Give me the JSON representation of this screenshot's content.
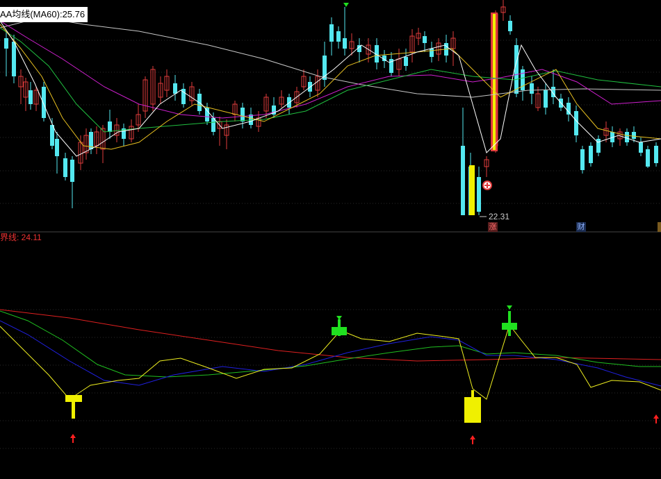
{
  "header": {
    "ma_label": "AA均线(MA60):25.76",
    "indicator_label": "界线: 24.11"
  },
  "annotations": {
    "low_price": "22.31",
    "badge_zhang": "涨",
    "badge_cai": "财"
  },
  "colors": {
    "background": "#000000",
    "up_candle": "#e03c3c",
    "down_candle": "#54e8f0",
    "ma_white": "#ffffff",
    "ma_yellow": "#e8c020",
    "ma_magenta": "#d020d0",
    "ma_green": "#20c040",
    "ma_gray": "#c8c8c8",
    "ind_red": "#e02020",
    "ind_green": "#20c020",
    "ind_blue": "#2020e0",
    "ind_yellow": "#f0f020",
    "signal_yellow": "#f0f000",
    "signal_green": "#20e020"
  },
  "chart_data": {
    "type": "line",
    "panels": [
      "price",
      "indicator"
    ],
    "price_series": [
      "white",
      "yellow",
      "magenta",
      "green",
      "gray"
    ],
    "ma60_value": 25.76,
    "indicator_boundary_value": 24.11,
    "marked_low": 22.31
  }
}
